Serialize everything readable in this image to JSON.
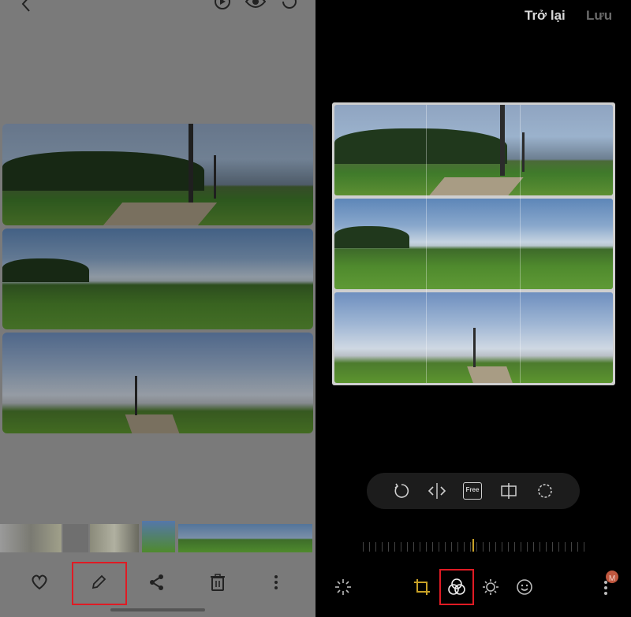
{
  "left_panel": {
    "top_bar": {
      "back_icon": "chevron-left-icon",
      "icons": [
        "motion-play-icon",
        "eye-icon",
        "remaster-icon"
      ]
    },
    "bottom_bar": {
      "buttons": [
        "heart-icon",
        "pencil-edit-icon",
        "share-icon",
        "trash-icon",
        "more-vertical-icon"
      ],
      "highlighted": "pencil-edit-icon"
    }
  },
  "right_panel": {
    "header": {
      "back_label": "Trở lại",
      "save_label": "Lưu"
    },
    "transform_tools": [
      "rotate-icon",
      "flip-icon",
      "free-ratio-icon",
      "perspective-icon",
      "lasso-icon"
    ],
    "free_label": "Free",
    "bottom_tools": [
      "auto-enhance-icon",
      "crop-rotate-icon",
      "filter-icon",
      "brightness-icon",
      "sticker-icon",
      "more-vertical-icon"
    ],
    "highlighted": "filter-icon",
    "notification_badge": "M",
    "colors": {
      "accent": "#c9a227",
      "highlight_border": "#e01b24",
      "save_disabled": "#6b6b6b"
    }
  }
}
